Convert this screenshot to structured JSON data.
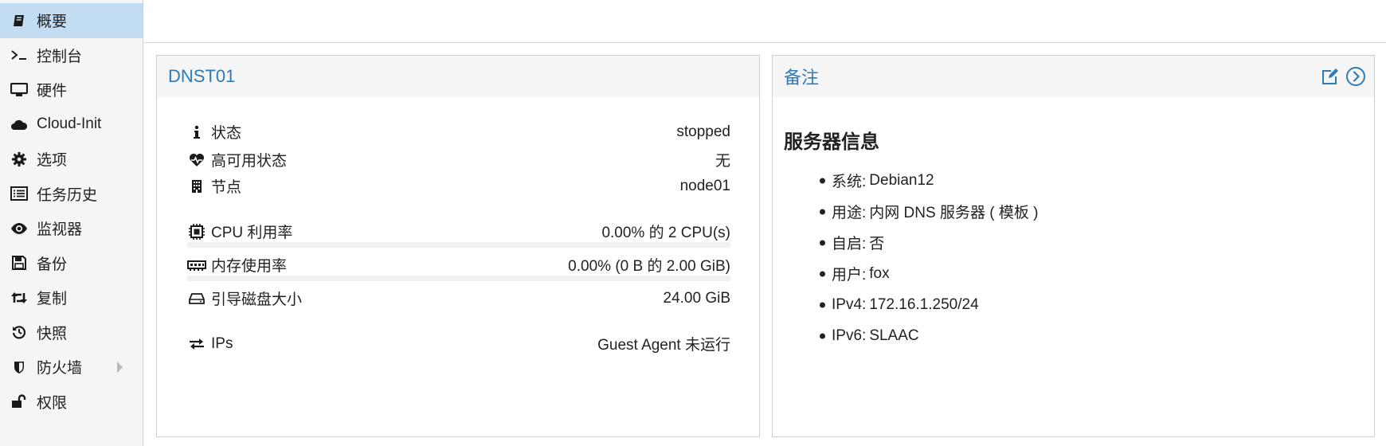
{
  "sidebar": {
    "items": [
      {
        "label": "概要",
        "icon": "book-icon",
        "active": true
      },
      {
        "label": "控制台",
        "icon": "terminal-icon"
      },
      {
        "label": "硬件",
        "icon": "monitor-icon"
      },
      {
        "label": "Cloud-Init",
        "icon": "cloud-icon"
      },
      {
        "label": "选项",
        "icon": "gear-icon"
      },
      {
        "label": "任务历史",
        "icon": "list-icon"
      },
      {
        "label": "监视器",
        "icon": "eye-icon"
      },
      {
        "label": "备份",
        "icon": "floppy-icon"
      },
      {
        "label": "复制",
        "icon": "retweet-icon"
      },
      {
        "label": "快照",
        "icon": "history-icon"
      },
      {
        "label": "防火墙",
        "icon": "shield-icon",
        "has_submenu": true
      },
      {
        "label": "权限",
        "icon": "unlock-icon"
      }
    ]
  },
  "status_panel": {
    "title": "DNST01",
    "rows": [
      {
        "key": "状态",
        "value": "stopped",
        "icon": "info-icon"
      },
      {
        "key": "高可用状态",
        "value": "无",
        "icon": "heartbeat-icon"
      },
      {
        "key": "节点",
        "value": "node01",
        "icon": "building-icon"
      },
      {
        "key": "CPU 利用率",
        "value": "0.00% 的 2 CPU(s)",
        "icon": "cpu-icon"
      },
      {
        "key": "内存使用率",
        "value": "0.00% (0 B 的 2.00 GiB)",
        "icon": "memory-icon"
      },
      {
        "key": "引导磁盘大小",
        "value": "24.00 GiB",
        "icon": "hdd-icon"
      },
      {
        "key": "IPs",
        "value": "Guest Agent 未运行",
        "icon": "exchange-icon"
      }
    ]
  },
  "notes_panel": {
    "title": "备注",
    "heading": "服务器信息",
    "items": [
      {
        "label": "系统:",
        "value": "Debian12"
      },
      {
        "label": "用途:",
        "value": "内网 DNS 服务器 ( 模板 )"
      },
      {
        "label": "自启:",
        "value": "否"
      },
      {
        "label": "用户:",
        "value": "fox"
      },
      {
        "label": "IPv4:",
        "value": "172.16.1.250/24"
      },
      {
        "label": "IPv6:",
        "value": "SLAAC"
      }
    ],
    "tools": [
      "edit-icon",
      "chevron-right-circle-icon"
    ]
  },
  "colors": {
    "accent": "#2e7bb8",
    "active_bg": "#c2dcf2",
    "sidebar_bg": "#f5f5f5",
    "header_bg": "#f5f5f5"
  }
}
